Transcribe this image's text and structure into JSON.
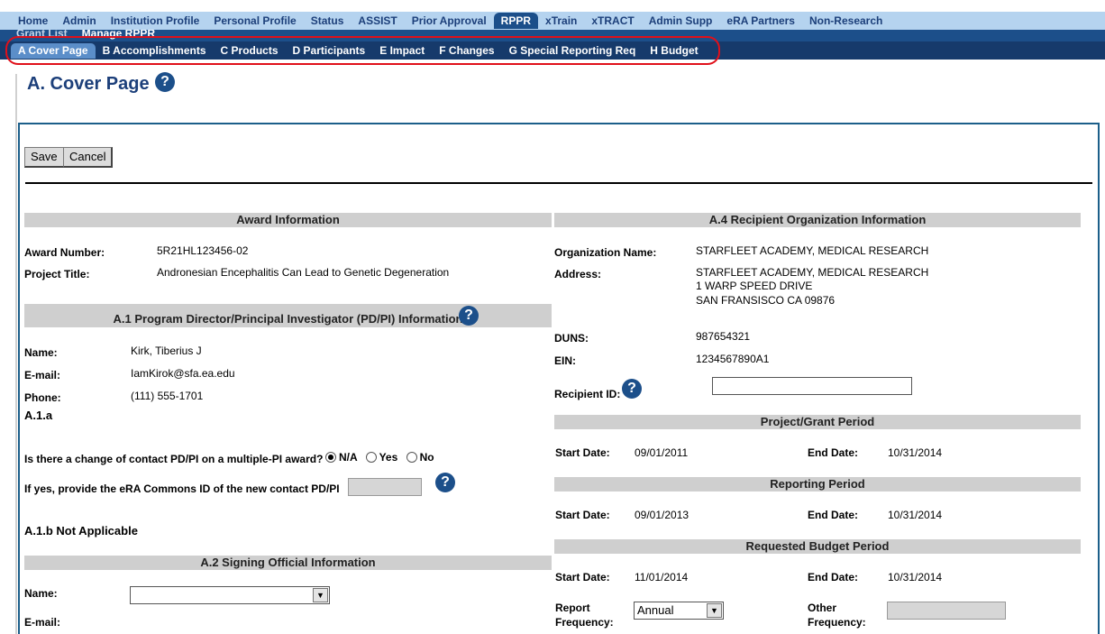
{
  "topnav": {
    "tabs": [
      "Home",
      "Admin",
      "Institution Profile",
      "Personal Profile",
      "Status",
      "ASSIST",
      "Prior Approval",
      "RPPR",
      "xTrain",
      "xTRACT",
      "Admin Supp",
      "eRA Partners",
      "Non-Research"
    ],
    "active": "RPPR"
  },
  "subnav": {
    "items": [
      "Grant List",
      "Manage RPPR"
    ]
  },
  "rpprnav": {
    "items": [
      "A Cover Page",
      "B Accomplishments",
      "C Products",
      "D Participants",
      "E Impact",
      "F Changes",
      "G Special Reporting Req",
      "H Budget"
    ],
    "active": "A Cover Page"
  },
  "page": {
    "title": "A. Cover Page"
  },
  "buttons": {
    "save": "Save",
    "cancel": "Cancel"
  },
  "award": {
    "heading": "Award Information",
    "award_number_label": "Award Number:",
    "award_number": "5R21HL123456-02",
    "project_title_label": "Project Title:",
    "project_title": "Andronesian Encephalitis Can Lead to Genetic Degeneration"
  },
  "pdpi": {
    "heading": "A.1 Program Director/Principal Investigator (PD/PI) Information",
    "name_label": "Name:",
    "name": "Kirk, Tiberius J",
    "email_label": "E-mail:",
    "email": "IamKirok@sfa.ea.edu",
    "phone_label": "Phone:",
    "phone": "(111) 555-1701",
    "a1a": "A.1.a",
    "change_question": "Is there a change of contact PD/PI on a multiple-PI award?",
    "options": [
      "N/A",
      "Yes",
      "No"
    ],
    "selected": "N/A",
    "commons_question": "If yes, provide the eRA Commons ID of the new contact PD/PI",
    "a1b": "A.1.b Not Applicable"
  },
  "signing": {
    "heading": "A.2 Signing Official Information",
    "name_label": "Name:",
    "email_label": "E-mail:"
  },
  "recipient": {
    "heading": "A.4 Recipient Organization Information",
    "org_label": "Organization Name:",
    "org": "STARFLEET ACADEMY, MEDICAL RESEARCH",
    "address_label": "Address:",
    "address_line1": "STARFLEET ACADEMY, MEDICAL RESEARCH",
    "address_line2": "1 WARP SPEED DRIVE",
    "address_line3": "SAN FRANSISCO CA  09876",
    "duns_label": "DUNS:",
    "duns": "987654321",
    "ein_label": "EIN:",
    "ein": "1234567890A1",
    "recipient_id_label": "Recipient ID:"
  },
  "grant_period": {
    "heading": "Project/Grant Period",
    "start_label": "Start Date:",
    "start": "09/01/2011",
    "end_label": "End Date:",
    "end": "10/31/2014"
  },
  "reporting_period": {
    "heading": "Reporting Period",
    "start_label": "Start Date:",
    "start": "09/01/2013",
    "end_label": "End Date:",
    "end": "10/31/2014"
  },
  "budget_period": {
    "heading": "Requested Budget Period",
    "start_label": "Start Date:",
    "start": "11/01/2014",
    "end_label": "End Date:",
    "end": "10/31/2014",
    "frequency_label_1": "Report",
    "frequency_label_2": "Frequency:",
    "frequency": "Annual",
    "other_label_1": "Other",
    "other_label_2": "Frequency:"
  },
  "help_glyph": "?"
}
